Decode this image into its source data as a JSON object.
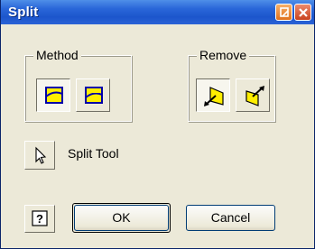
{
  "window": {
    "title": "Split"
  },
  "titlebar": {
    "help_icon": "help-icon",
    "close_icon": "close-icon"
  },
  "method_group": {
    "label": "Method",
    "buttons": [
      {
        "icon": "split-face-icon",
        "state": "pressed"
      },
      {
        "icon": "split-part-icon",
        "state": "normal"
      }
    ]
  },
  "remove_group": {
    "label": "Remove",
    "buttons": [
      {
        "icon": "remove-direction-1-icon",
        "state": "pressed"
      },
      {
        "icon": "remove-direction-2-icon",
        "state": "normal"
      }
    ]
  },
  "split_tool": {
    "label": "Split Tool",
    "icon": "cursor-arrow-icon"
  },
  "footer": {
    "help_icon": "help-icon",
    "ok_label": "OK",
    "cancel_label": "Cancel"
  },
  "colors": {
    "title_bar": "#1c55cc",
    "dialog_bg": "#ece9d8",
    "icon_yellow": "#ffef00",
    "icon_outline": "#0000a8"
  }
}
